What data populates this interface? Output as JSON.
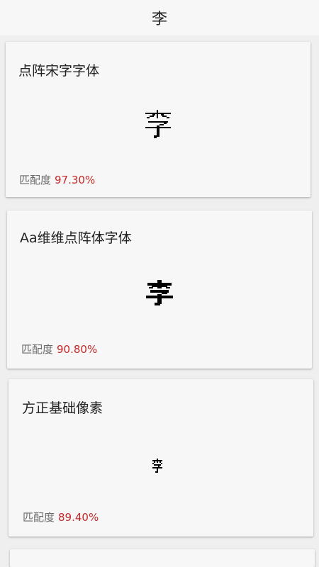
{
  "header": {
    "title": "李"
  },
  "match_label": "匹配度",
  "accent_color": "#c62828",
  "cards": [
    {
      "font_name": "点阵宋字字体",
      "match": "97.30%",
      "glyph": "李"
    },
    {
      "font_name": "Aa维维点阵体字体",
      "match": "90.80%",
      "glyph": "李"
    },
    {
      "font_name": "方正基础像素",
      "match": "89.40%",
      "glyph": "李"
    }
  ]
}
